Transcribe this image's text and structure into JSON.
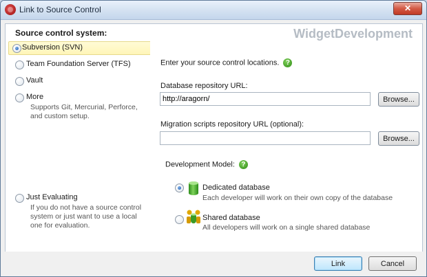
{
  "window": {
    "title": "Link to Source Control",
    "close_glyph": "✕"
  },
  "left": {
    "section_title": "Source control system:",
    "options": [
      {
        "label": "Subversion (SVN)",
        "selected": true
      },
      {
        "label": "Team Foundation Server (TFS)",
        "selected": false
      },
      {
        "label": "Vault",
        "selected": false
      },
      {
        "label": "More",
        "selected": false,
        "description": "Supports Git, Mercurial, Perforce, and custom setup."
      }
    ],
    "evaluating": {
      "label": "Just Evaluating",
      "description": "If you do not have a source control system or just want to use a local one for evaluation."
    }
  },
  "right": {
    "brand": "WidgetDevelopment",
    "intro": "Enter your source control locations.",
    "help_glyph": "?",
    "db_repo_label": "Database repository URL:",
    "db_repo_value": "http://aragorn/",
    "migration_label": "Migration scripts repository URL (optional):",
    "migration_value": "",
    "browse_label": "Browse...",
    "dev_model_label": "Development Model:",
    "models": [
      {
        "title": "Dedicated database",
        "description": "Each developer will work on their own copy of the database",
        "selected": true
      },
      {
        "title": "Shared database",
        "description": "All developers will work on a single shared database",
        "selected": false
      }
    ]
  },
  "footer": {
    "link_label": "Link",
    "cancel_label": "Cancel"
  },
  "colors": {
    "selection_bg": "#fff5b8",
    "help_green": "#2f8a15",
    "db_green": "#2d8c1a",
    "brand_gray": "#b5bcc4"
  }
}
